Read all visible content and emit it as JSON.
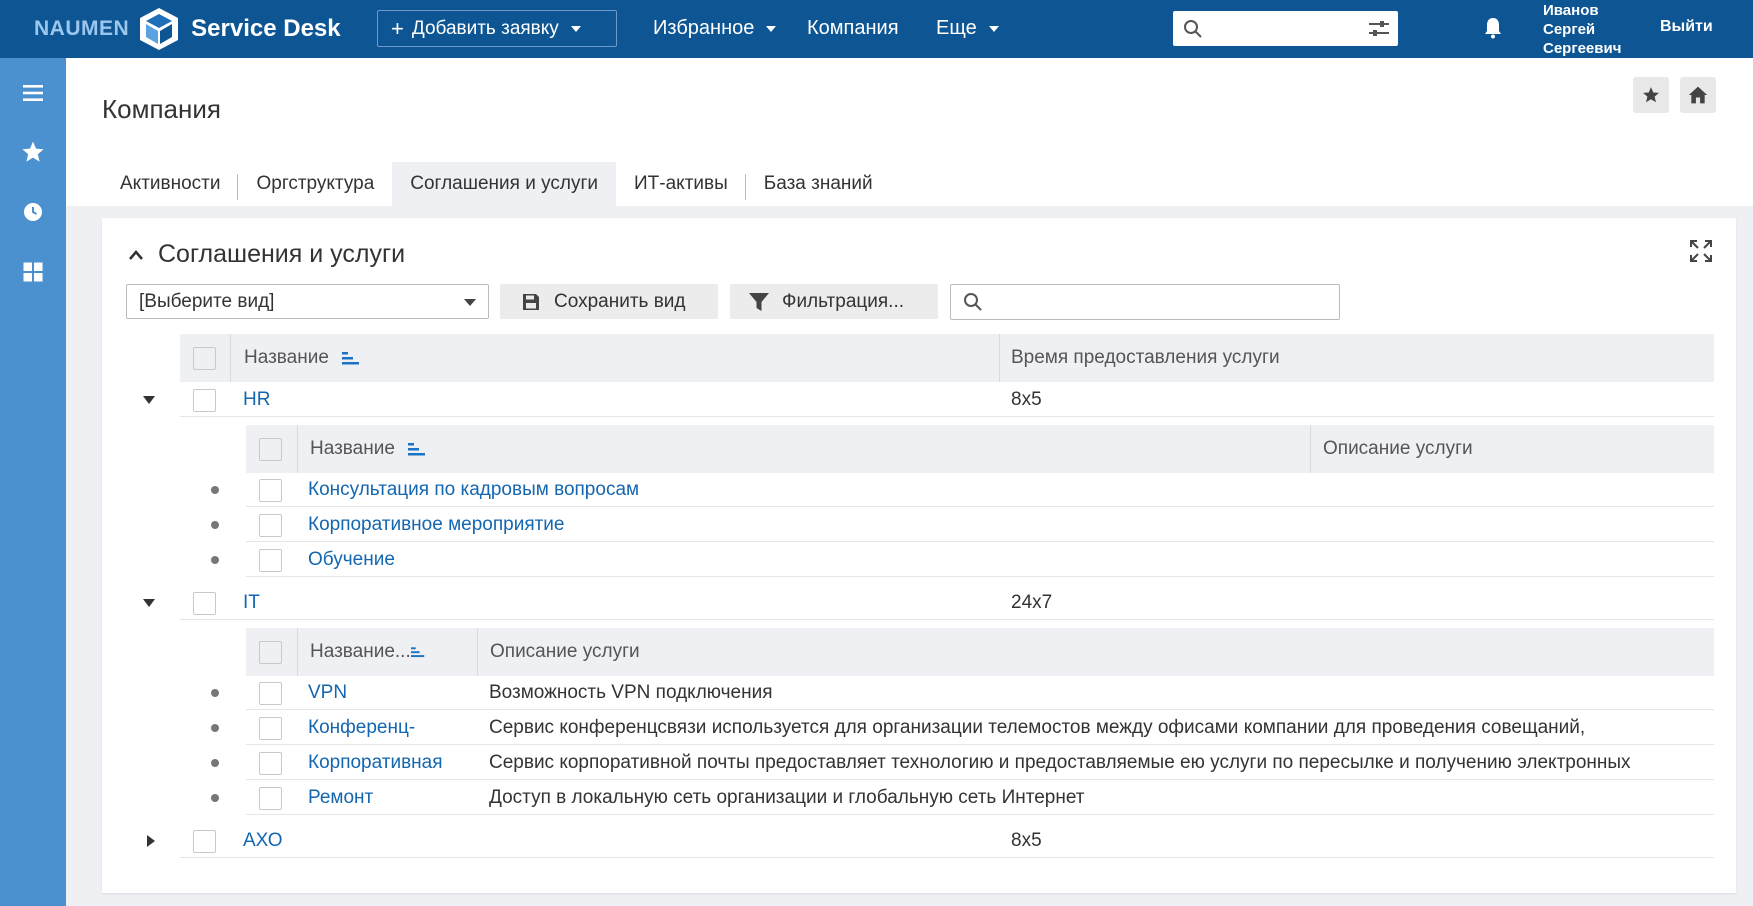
{
  "topbar": {
    "logo_left": "NAUMEN",
    "logo_right": "Service Desk",
    "add_button": "Добавить заявку",
    "nav": [
      "Избранное",
      "Компания",
      "Еще"
    ],
    "search_placeholder": "",
    "user_name": [
      "Иванов",
      "Сергей",
      "Сергеевич"
    ],
    "logout": "Выйти"
  },
  "page": {
    "title": "Компания",
    "tabs": [
      "Активности",
      "Оргструктура",
      "Соглашения и услуги",
      "ИТ-активы",
      "База знаний"
    ],
    "active_tab": 2
  },
  "panel": {
    "title": "Соглашения и услуги",
    "view_select": "[Выберите вид]",
    "save_view": "Сохранить вид",
    "filter": "Фильтрация...",
    "search_placeholder": ""
  },
  "table": {
    "headers": [
      "Название",
      "Время предоставления услуги"
    ],
    "groups": [
      {
        "name": "HR",
        "time": "8x5",
        "expanded": true,
        "sub_headers": [
          "Название",
          "Описание услуги"
        ],
        "items": [
          {
            "name": "Консультация по кадровым вопросам",
            "desc": ""
          },
          {
            "name": "Корпоративное мероприятие",
            "desc": ""
          },
          {
            "name": "Обучение",
            "desc": ""
          }
        ]
      },
      {
        "name": "IT",
        "time": "24x7",
        "expanded": true,
        "sub_headers": [
          "Название...",
          "Описание услуги"
        ],
        "items": [
          {
            "name": "VPN",
            "desc": "Возможность VPN подключения"
          },
          {
            "name": "Конференц-",
            "desc": "Сервис конференцсвязи используется для организации телемостов между офисами компании для проведения совещаний,"
          },
          {
            "name": "Корпоративная",
            "desc": "Сервис корпоративной почты предоставляет технологию и предоставляемые ею услуги по пересылке и получению электронных"
          },
          {
            "name": "Ремонт",
            "desc": "Доступ в локальную сеть организации и глобальную сеть Интернет"
          }
        ]
      },
      {
        "name": "АХО",
        "time": "8x5",
        "expanded": false,
        "sub_headers": [],
        "items": []
      }
    ]
  },
  "colors": {
    "topbar": "#0e5693",
    "sidebar": "#4b91cf",
    "link": "#1366b0",
    "header_bg": "#eef0f3"
  }
}
